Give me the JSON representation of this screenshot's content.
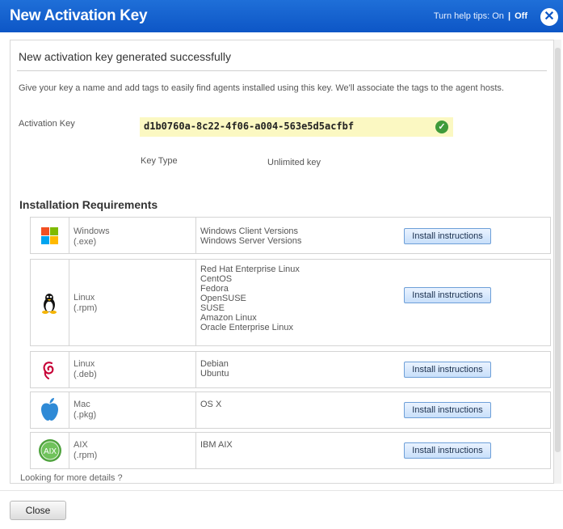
{
  "dialog": {
    "title": "New Activation Key",
    "help_label": "Turn help tips:",
    "help_on": "On",
    "help_sep": "|",
    "help_off": "Off",
    "close_icon_glyph": "✕"
  },
  "body": {
    "success_message": "New activation key generated successfully",
    "info_text": "Give your key a name and add tags to easily find agents installed using this key. We'll associate the tags to the agent hosts.",
    "activation_key_label": "Activation Key",
    "activation_key_value": "d1b0760a-8c22-4f06-a004-563e5d5acfbf",
    "key_type_label": "Key Type",
    "key_type_value": "Unlimited key"
  },
  "requirements": {
    "title": "Installation Requirements",
    "rows": [
      {
        "icon": "windows-icon",
        "os": "Windows",
        "pkg": "(.exe)",
        "versions": [
          "Windows Client Versions",
          "Windows Server Versions"
        ],
        "button": "Install instructions"
      },
      {
        "icon": "linux-penguin-icon",
        "os": "Linux",
        "pkg": "(.rpm)",
        "versions": [
          "Red Hat Enterprise Linux",
          "CentOS",
          "Fedora",
          "OpenSUSE",
          "SUSE",
          "Amazon Linux",
          "Oracle Enterprise Linux"
        ],
        "button": "Install instructions"
      },
      {
        "icon": "debian-swirl-icon",
        "os": "Linux",
        "pkg": "(.deb)",
        "versions": [
          "Debian",
          "Ubuntu"
        ],
        "button": "Install instructions"
      },
      {
        "icon": "apple-icon",
        "os": "Mac",
        "pkg": "(.pkg)",
        "versions": [
          "OS X"
        ],
        "button": "Install instructions"
      },
      {
        "icon": "aix-icon",
        "os": "AIX",
        "pkg": "(.rpm)",
        "versions": [
          "IBM AIX"
        ],
        "button": "Install instructions",
        "icon_text": "AIX"
      }
    ],
    "more_details": "Looking for more details ?"
  },
  "footer": {
    "close_label": "Close"
  },
  "colors": {
    "header": "#0d56c6",
    "key_highlight": "#fbf8c2",
    "check_green": "#3f9b3a"
  }
}
